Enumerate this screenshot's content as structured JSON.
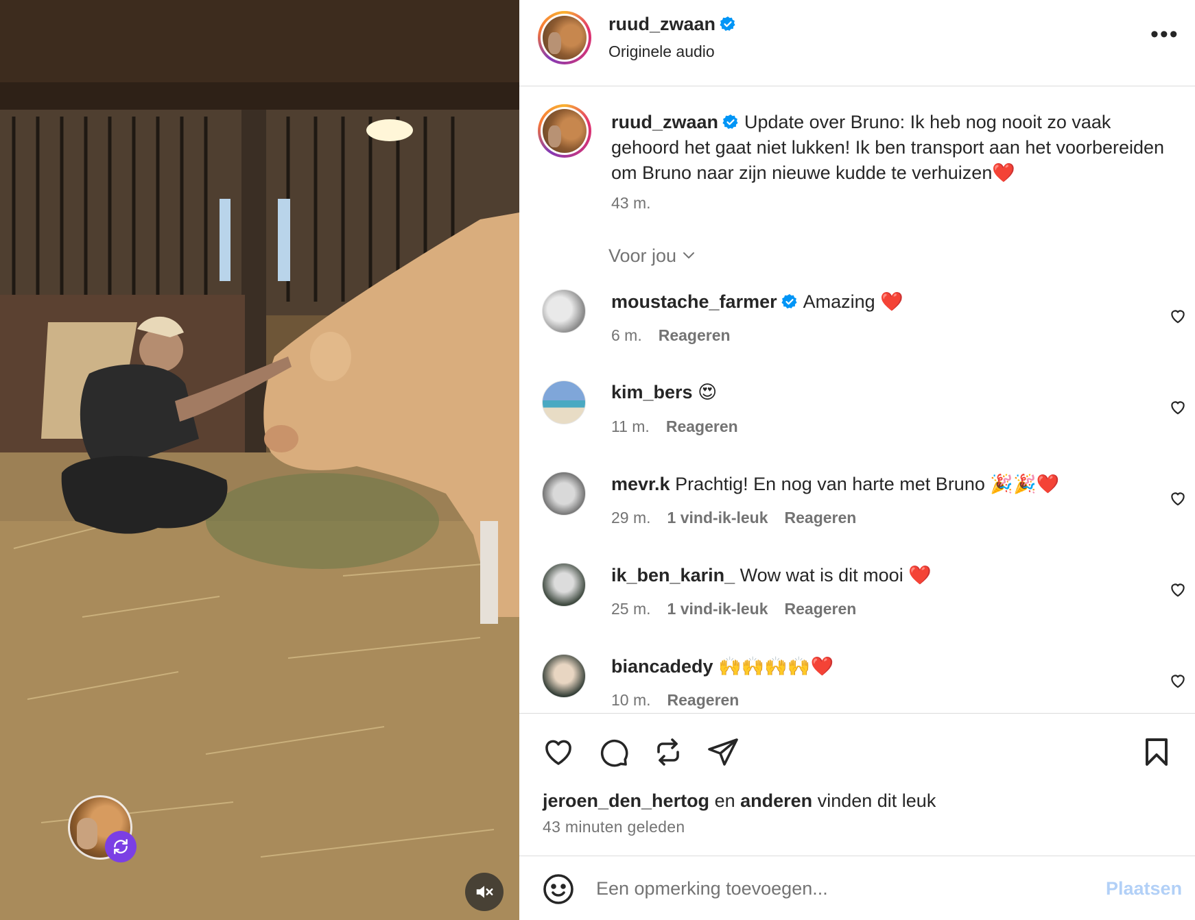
{
  "header": {
    "username": "ruud_zwaan",
    "subtitle": "Originele audio",
    "more_label": "•••"
  },
  "caption": {
    "username": "ruud_zwaan",
    "text": "Update over Bruno: Ik heb nog nooit zo vaak gehoord het gaat niet lukken! Ik ben transport aan het voorbereiden om Bruno naar zijn nieuwe kudde te verhuizen❤️",
    "time": "43 m."
  },
  "sort": {
    "label": "Voor jou"
  },
  "comments": [
    {
      "username": "moustache_farmer",
      "verified": true,
      "text": "Amazing ❤️",
      "time": "6 m.",
      "likes": "",
      "reply": "Reageren"
    },
    {
      "username": "kim_bers",
      "verified": false,
      "text": "😍",
      "time": "11 m.",
      "likes": "",
      "reply": "Reageren"
    },
    {
      "username": "mevr.k",
      "verified": false,
      "text": "Prachtig! En nog van harte met Bruno 🎉🎉❤️",
      "time": "29 m.",
      "likes": "1 vind-ik-leuk",
      "reply": "Reageren"
    },
    {
      "username": "ik_ben_karin_",
      "verified": false,
      "text": "Wow wat is dit mooi ❤️",
      "time": "25 m.",
      "likes": "1 vind-ik-leuk",
      "reply": "Reageren"
    },
    {
      "username": "biancadedy",
      "verified": false,
      "text": "🙌🙌🙌🙌❤️",
      "time": "10 m.",
      "likes": "",
      "reply": "Reageren"
    }
  ],
  "likes_line": {
    "user": "jeroen_den_hertog",
    "connector": "en",
    "others": "anderen",
    "suffix": "vinden dit leuk"
  },
  "post_time": "43 minuten geleden",
  "add_comment": {
    "placeholder": "Een opmerking toevoegen...",
    "post_label": "Plaatsen"
  },
  "colors": {
    "verified": "#0095f6",
    "muted_text": "#737373",
    "post_button": "#b2d0f7",
    "remix_badge": "#7b3fe4"
  },
  "icons": [
    "verified-badge-icon",
    "more-icon",
    "chevron-down-icon",
    "heart-icon",
    "comment-icon",
    "repost-icon",
    "share-icon",
    "bookmark-icon",
    "emoji-icon",
    "mute-icon",
    "remix-icon"
  ]
}
